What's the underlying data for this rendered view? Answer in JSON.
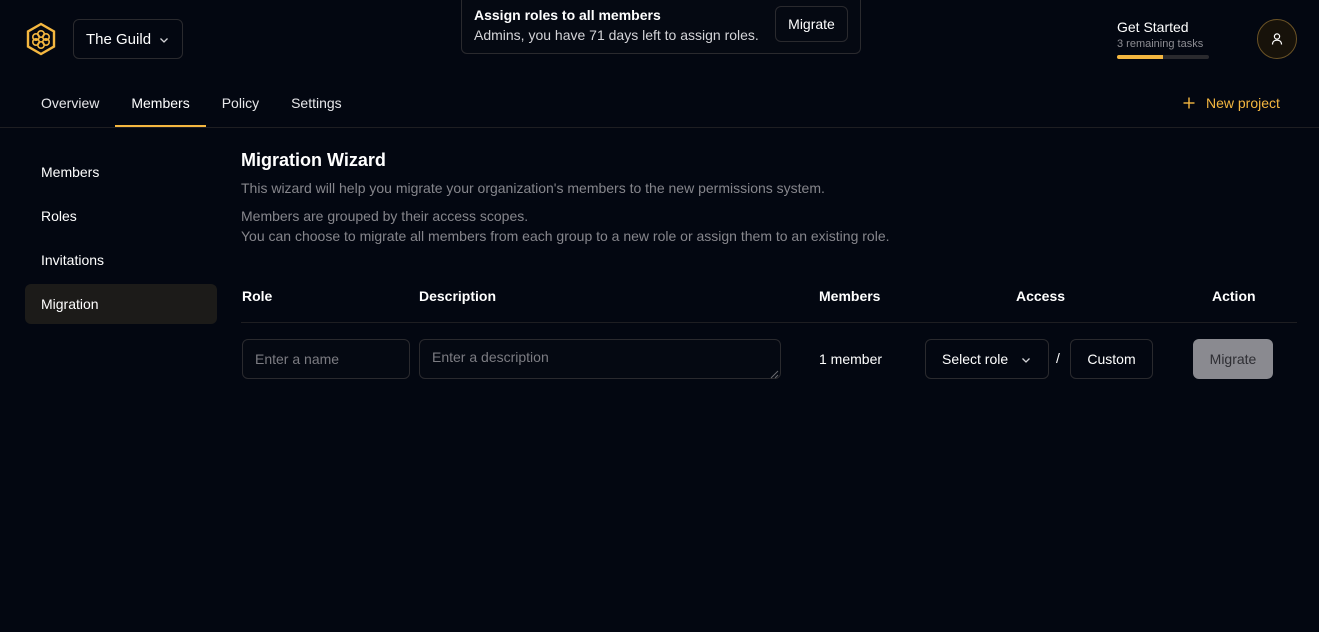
{
  "org": {
    "name": "The Guild"
  },
  "banner": {
    "title": "Assign roles to all members",
    "text": "Admins, you have 71 days left to assign roles.",
    "button": "Migrate"
  },
  "get_started": {
    "title": "Get Started",
    "subtitle": "3 remaining tasks",
    "progress": 0.5
  },
  "tabs": [
    {
      "label": "Overview"
    },
    {
      "label": "Members"
    },
    {
      "label": "Policy"
    },
    {
      "label": "Settings"
    }
  ],
  "new_project": "New project",
  "sidebar": {
    "items": [
      {
        "label": "Members"
      },
      {
        "label": "Roles"
      },
      {
        "label": "Invitations"
      },
      {
        "label": "Migration"
      }
    ]
  },
  "main": {
    "title": "Migration Wizard",
    "description": "This wizard will help you migrate your organization's members to the new permissions system.",
    "info_line1": "Members are grouped by their access scopes.",
    "info_line2": "You can choose to migrate all members from each group to a new role or assign them to an existing role."
  },
  "table": {
    "headers": {
      "role": "Role",
      "description": "Description",
      "members": "Members",
      "access": "Access",
      "action": "Action"
    },
    "row": {
      "name_placeholder": "Enter a name",
      "description_placeholder": "Enter a description",
      "members": "1 member",
      "role_select": "Select role",
      "separator": "/",
      "custom": "Custom",
      "action": "Migrate"
    }
  },
  "colors": {
    "accent": "#f4b740",
    "background": "#030711",
    "border": "#2a2a2e"
  }
}
